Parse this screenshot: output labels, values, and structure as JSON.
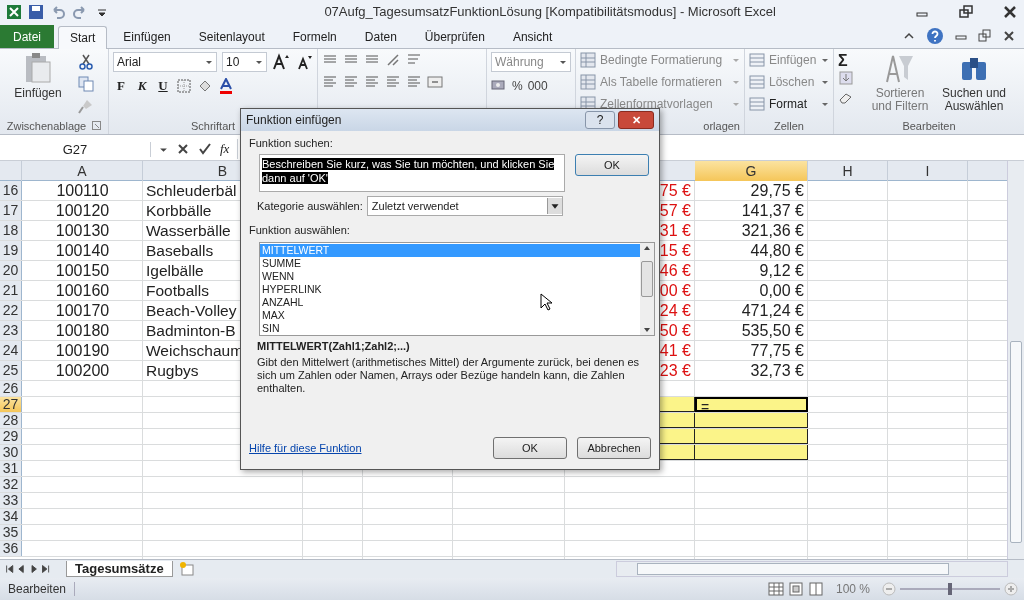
{
  "window": {
    "title": "07Aufg_TagesumsatzFunktionLösung  [Kompatibilitätsmodus]  -  Microsoft Excel"
  },
  "tabs": [
    {
      "label": "Datei",
      "kind": "file",
      "selected": false
    },
    {
      "label": "Start",
      "kind": "tab",
      "selected": true
    },
    {
      "label": "Einfügen",
      "kind": "tab",
      "selected": false
    },
    {
      "label": "Seitenlayout",
      "kind": "tab",
      "selected": false
    },
    {
      "label": "Formeln",
      "kind": "tab",
      "selected": false
    },
    {
      "label": "Daten",
      "kind": "tab",
      "selected": false
    },
    {
      "label": "Überprüfen",
      "kind": "tab",
      "selected": false
    },
    {
      "label": "Ansicht",
      "kind": "tab",
      "selected": false
    }
  ],
  "ribbon": {
    "clipboard": {
      "paste": "Einfügen",
      "label": "Zwischenablage"
    },
    "font": {
      "name": "Arial",
      "size": "10",
      "bold": "F",
      "italic": "K",
      "underline": "U",
      "label": "Schriftart"
    },
    "number": {
      "format": "Währung",
      "percent": "%",
      "thousands": "000"
    },
    "styles": {
      "items": [
        "Bedingte Formatierung",
        "Als Tabelle formatieren",
        "Zellenformatvorlagen"
      ],
      "label": "orlagen"
    },
    "cells": {
      "items": [
        "Einfügen",
        "Löschen",
        "Format"
      ],
      "label": "Zellen"
    },
    "editing": {
      "sum": "Σ",
      "sort": "Sortieren und Filtern",
      "find": "Suchen und Auswählen",
      "label": "Bearbeiten"
    }
  },
  "formula_bar": {
    "name_box": "G27",
    "fx": "fx"
  },
  "sheet": {
    "columns": [
      {
        "label": "A",
        "selected": false
      },
      {
        "label": "B",
        "selected": false
      },
      {
        "label": "G",
        "selected": true
      },
      {
        "label": "H",
        "selected": false
      },
      {
        "label": "I",
        "selected": false
      }
    ],
    "rows": [
      {
        "number": "16",
        "a": "100110",
        "b": "Schleuderbäl",
        "f": "75 €",
        "g": "29,75 €",
        "selected": false,
        "input": false
      },
      {
        "number": "17",
        "a": "100120",
        "b": "Korbbälle",
        "f": "57 €",
        "g": "141,37 €",
        "selected": false,
        "input": false
      },
      {
        "number": "18",
        "a": "100130",
        "b": "Wasserbälle",
        "f": "31 €",
        "g": "321,36 €",
        "selected": false,
        "input": false
      },
      {
        "number": "19",
        "a": "100140",
        "b": "Baseballs",
        "f": "15 €",
        "g": "44,80 €",
        "selected": false,
        "input": false
      },
      {
        "number": "20",
        "a": "100150",
        "b": "Igelbälle",
        "f": "46 €",
        "g": "9,12 €",
        "selected": false,
        "input": false
      },
      {
        "number": "21",
        "a": "100160",
        "b": "Footballs",
        "f": "00 €",
        "g": "0,00 €",
        "selected": false,
        "input": false
      },
      {
        "number": "22",
        "a": "100170",
        "b": "Beach-Volley",
        "f": "24 €",
        "g": "471,24 €",
        "selected": false,
        "input": false
      },
      {
        "number": "23",
        "a": "100180",
        "b": "Badminton-B",
        "f": "50 €",
        "g": "535,50 €",
        "selected": false,
        "input": false
      },
      {
        "number": "24",
        "a": "100190",
        "b": "Weichschaum",
        "f": "41 €",
        "g": "77,75 €",
        "selected": false,
        "input": false
      },
      {
        "number": "25",
        "a": "100200",
        "b": "Rugbys",
        "f": "23 €",
        "g": "32,73 €",
        "selected": false,
        "input": false
      },
      {
        "number": "26",
        "selected": false,
        "input": false
      },
      {
        "number": "27",
        "g": "=",
        "selected": true,
        "input": true
      },
      {
        "number": "28",
        "selected": false,
        "input": true
      },
      {
        "number": "29",
        "selected": false,
        "input": true
      },
      {
        "number": "30",
        "selected": false,
        "input": true
      },
      {
        "number": "31",
        "selected": false,
        "input": false
      },
      {
        "number": "32",
        "selected": false,
        "input": false
      },
      {
        "number": "33",
        "selected": false,
        "input": false
      },
      {
        "number": "34",
        "selected": false,
        "input": false
      },
      {
        "number": "35",
        "selected": false,
        "input": false
      },
      {
        "number": "36",
        "selected": false,
        "input": false
      }
    ]
  },
  "sheet_tabs": [
    {
      "label": "Tagesumsätze",
      "selected": true
    }
  ],
  "status_bar": {
    "mode": "Bearbeiten",
    "zoom": "100 %",
    "zoom_slider": {
      "level": 0.5
    }
  },
  "dialog": {
    "title": "Funktion einfügen",
    "help": "?",
    "close": "✕",
    "search_label": "Funktion suchen:",
    "search_value": "Beschreiben Sie kurz, was Sie tun möchten, und klicken Sie dann auf 'OK'",
    "go_button": "OK",
    "category_label": "Kategorie auswählen:",
    "category": "Zuletzt verwendet",
    "list_label": "Funktion auswählen:",
    "functions": [
      {
        "name": "MITTELWERT",
        "selected": true
      },
      {
        "name": "SUMME",
        "selected": false
      },
      {
        "name": "WENN",
        "selected": false
      },
      {
        "name": "HYPERLINK",
        "selected": false
      },
      {
        "name": "ANZAHL",
        "selected": false
      },
      {
        "name": "MAX",
        "selected": false
      },
      {
        "name": "SIN",
        "selected": false
      }
    ],
    "syntax": "MITTELWERT(Zahl1;Zahl2;...)",
    "description": "Gibt den Mittelwert (arithmetisches Mittel) der Argumente zurück, bei denen es sich um Zahlen oder Namen, Arrays oder Bezüge handeln kann, die Zahlen enthalten.",
    "help_link": "Hilfe für diese Funktion",
    "buttons": [
      "OK",
      "Abbrechen"
    ]
  }
}
